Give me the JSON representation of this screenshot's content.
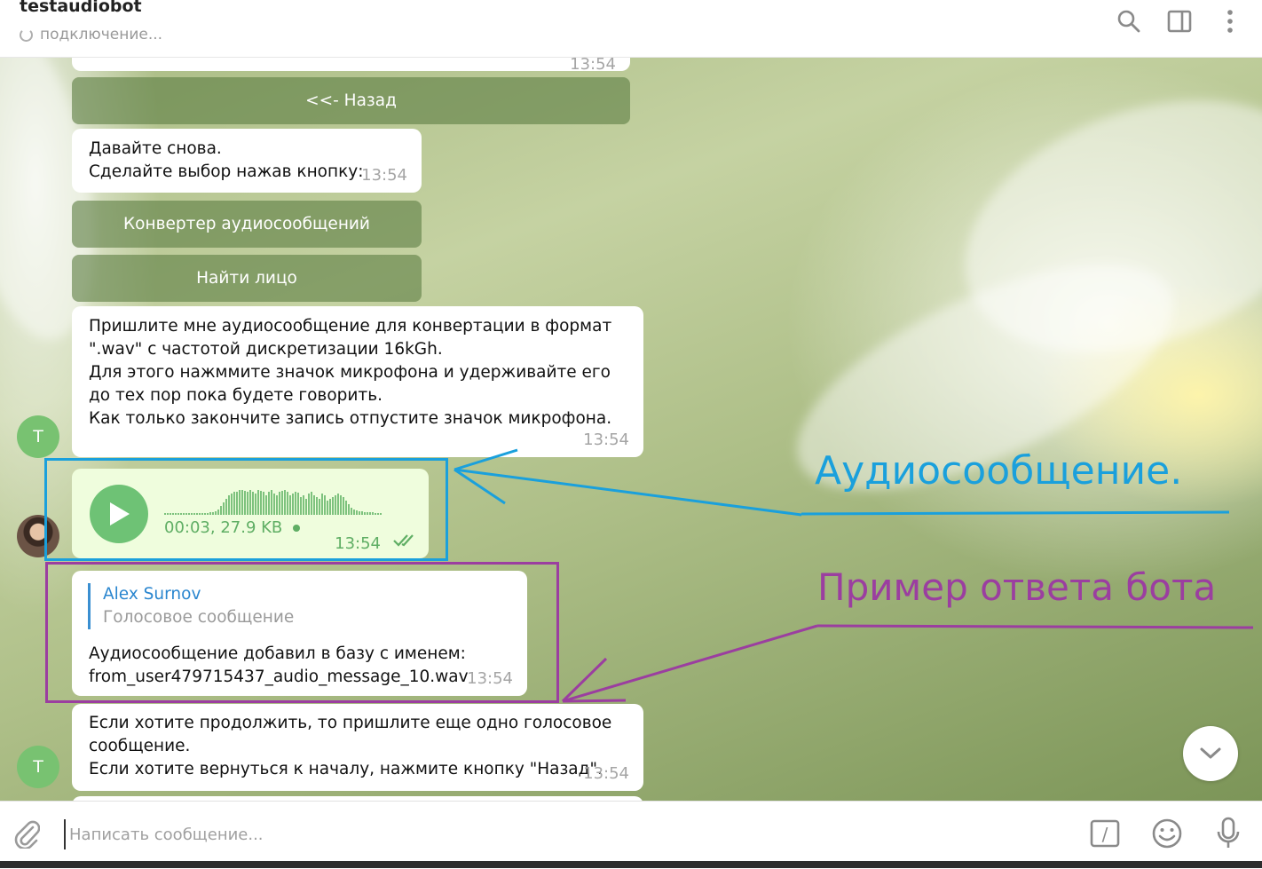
{
  "header": {
    "title": "testaudiobot",
    "status": "подключение..."
  },
  "messages": {
    "top_partial_time": "13:54",
    "back_button": "<<- Назад",
    "msg_again": {
      "text": "Давайте снова.\nСделайте выбор нажав кнопку:",
      "time": "13:54"
    },
    "kb_converter": "Конвертер аудиосообщений",
    "kb_find_face": "Найти лицо",
    "msg_instructions": {
      "text": "Пришлите мне аудиосообщение для конвертации в формат \".wav\" с частотой дискретизации 16kGh.\nДля этого нажммите значок микрофона и удерживайте его до тех пор пока будете говорить.\nКак только закончите запись отпустите значок микрофона.",
      "time": "13:54"
    },
    "bot_avatar_letter": "T",
    "voice": {
      "duration": "00:03, 27.9 KB",
      "time": "13:54"
    },
    "reply_msg": {
      "reply_name": "Alex Surnov",
      "reply_sub": "Голосовое сообщение",
      "text": "Аудиосообщение добавил в базу с именем:\nfrom_user479715437_audio_message_10.wav",
      "time": "13:54"
    },
    "msg_continue": {
      "text": "Если хотите продолжить, то пришлите еще одно голосовое сообщение.\nЕсли хотите вернуться к началу, нажмите кнопку \"Назад\".",
      "time": "13:54"
    }
  },
  "annotations": {
    "audio_label": "Аудиосообщение.",
    "audio_color": "#1aa0dc",
    "bot_label": "Пример ответа бота",
    "bot_color": "#9b3ea0"
  },
  "composer": {
    "placeholder": "Написать сообщение...",
    "command_symbol": "/"
  },
  "icons": [
    "search-icon",
    "sidebar-toggle-icon",
    "more-icon",
    "play-icon",
    "double-check-icon",
    "chevron-down-icon",
    "attach-icon",
    "bot-command-icon",
    "emoji-icon",
    "microphone-icon"
  ]
}
